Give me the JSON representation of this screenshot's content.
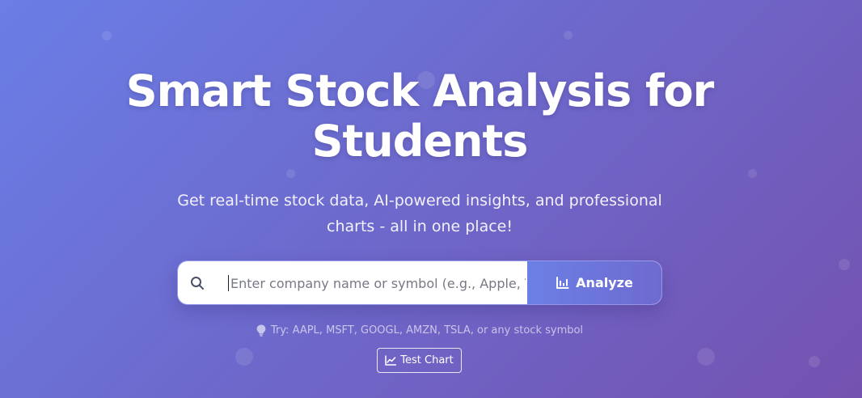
{
  "hero": {
    "title": "Smart Stock Analysis for Students",
    "subtitle": "Get real-time stock data, AI-powered insights, and professional charts - all in one place!"
  },
  "search": {
    "placeholder": "Enter company name or symbol (e.g., Apple, TSLA)",
    "value": "",
    "icon": "search-icon",
    "button_label": "Analyze",
    "button_icon": "bar-chart-icon"
  },
  "hint": {
    "icon": "lightbulb-icon",
    "text": "Try: AAPL, MSFT, GOOGL, AMZN, TSLA, or any stock symbol"
  },
  "test_chart": {
    "label": "Test Chart",
    "icon": "line-chart-icon"
  },
  "colors": {
    "background_start": "#6a7ee6",
    "background_end": "#7452b0",
    "button_start": "#6b80e4",
    "button_end": "#6e6ad0"
  }
}
